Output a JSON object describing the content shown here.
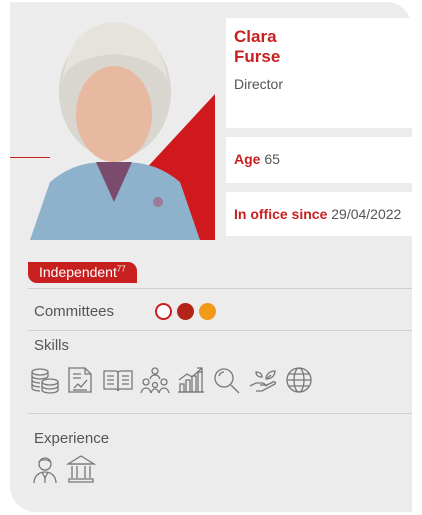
{
  "profile": {
    "first_name": "Clara",
    "last_name": "Furse",
    "role": "Director",
    "age_label": "Age",
    "age_value": "65",
    "office_label": "In office since",
    "office_value": "29/04/2022",
    "photo": "portrait-photo"
  },
  "badge": {
    "label": "Independent",
    "footnote": "77"
  },
  "committees": {
    "label": "Committees",
    "indicators": [
      {
        "name": "committee-indicator-outline",
        "style": "outline",
        "color": "#c8201f"
      },
      {
        "name": "committee-indicator-red",
        "style": "filled",
        "color": "#b32416"
      },
      {
        "name": "committee-indicator-orange",
        "style": "filled",
        "color": "#f29a18"
      }
    ]
  },
  "skills": {
    "label": "Skills",
    "icons": [
      "coins-icon",
      "report-icon",
      "book-icon",
      "team-icon",
      "growth-chart-icon",
      "magnifier-icon",
      "sustainability-hand-icon",
      "globe-icon"
    ]
  },
  "experience": {
    "label": "Experience",
    "icons": [
      "person-icon",
      "institution-icon"
    ]
  },
  "colors": {
    "accent": "#c8201f",
    "background": "#ececec",
    "icon_stroke": "#777777"
  }
}
